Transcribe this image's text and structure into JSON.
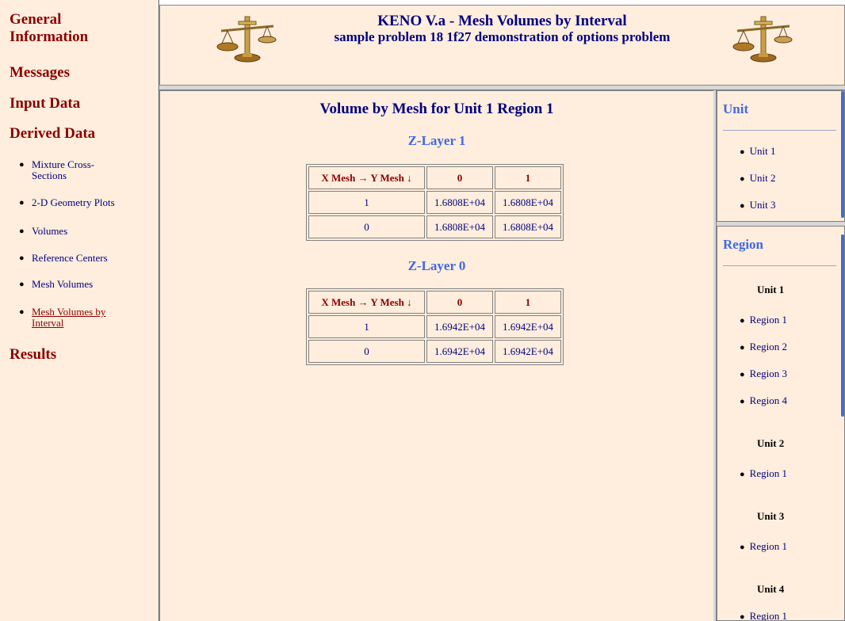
{
  "nav": {
    "general": "General Information",
    "messages": "Messages",
    "input": "Input Data",
    "derived": "Derived Data",
    "results": "Results",
    "sub_items": [
      {
        "label": "Mixture Cross-Sections"
      },
      {
        "label": "2-D Geometry Plots"
      },
      {
        "label": "Volumes"
      },
      {
        "label": "Reference Centers"
      },
      {
        "label": "Mesh Volumes"
      },
      {
        "label": "Mesh Volumes by Interval"
      }
    ]
  },
  "header": {
    "title": "KENO V.a - Mesh Volumes by Interval",
    "subtitle": "sample problem 18 1f27 demonstration of options problem"
  },
  "main": {
    "title": "Volume by Mesh for Unit 1 Region 1",
    "layers": [
      {
        "label": "Z-Layer 1",
        "header": [
          "X Mesh → Y Mesh ↓",
          "0",
          "1"
        ],
        "rows": [
          [
            "1",
            "1.6808E+04",
            "1.6808E+04"
          ],
          [
            "0",
            "1.6808E+04",
            "1.6808E+04"
          ]
        ]
      },
      {
        "label": "Z-Layer 0",
        "header": [
          "X Mesh → Y Mesh ↓",
          "0",
          "1"
        ],
        "rows": [
          [
            "1",
            "1.6942E+04",
            "1.6942E+04"
          ],
          [
            "0",
            "1.6942E+04",
            "1.6942E+04"
          ]
        ]
      }
    ]
  },
  "unit_panel": {
    "heading": "Unit",
    "items": [
      "Unit 1",
      "Unit 2",
      "Unit 3"
    ]
  },
  "region_panel": {
    "heading": "Region",
    "groups": [
      {
        "unit": "Unit 1",
        "regions": [
          "Region 1",
          "Region 2",
          "Region 3",
          "Region 4"
        ]
      },
      {
        "unit": "Unit 2",
        "regions": [
          "Region 1"
        ]
      },
      {
        "unit": "Unit 3",
        "regions": [
          "Region 1"
        ]
      },
      {
        "unit": "Unit 4",
        "regions": [
          "Region 1"
        ]
      }
    ]
  },
  "colors": {
    "background": "#ffeedd",
    "nav_text": "#8b0000",
    "link": "#000080",
    "subheading": "#4169e1"
  },
  "icons": [
    "balance-scale-icon"
  ]
}
